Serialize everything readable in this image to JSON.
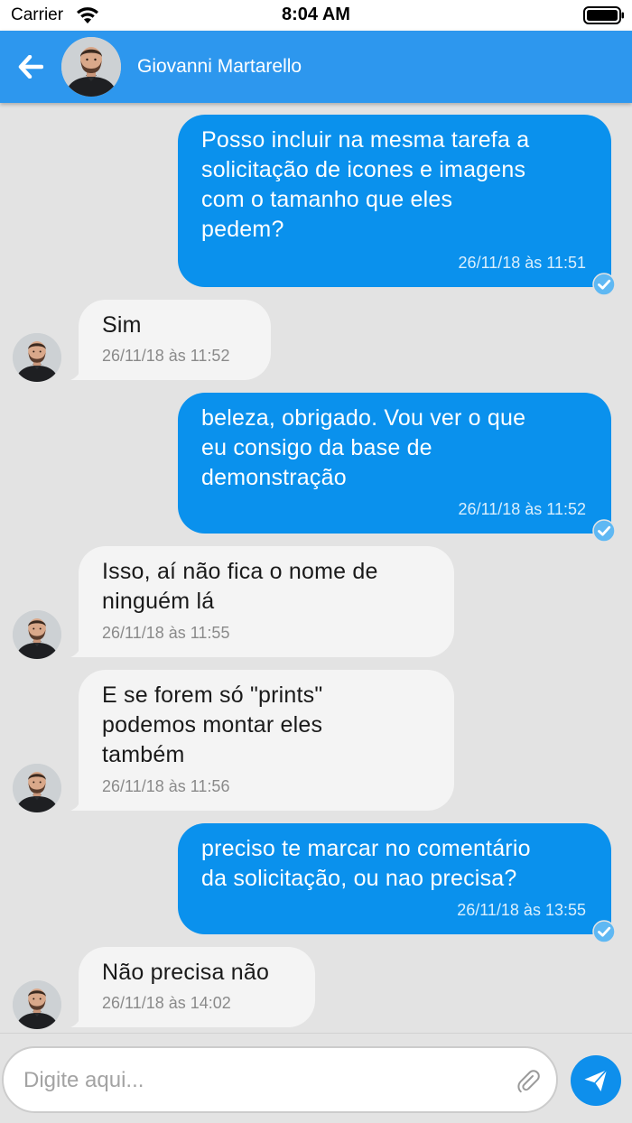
{
  "status_bar": {
    "carrier": "Carrier",
    "time": "8:04 AM",
    "icons": [
      "wifi-icon",
      "battery-icon"
    ]
  },
  "header": {
    "back_icon": "arrow-left-icon",
    "contact_name": "Giovanni Martarello",
    "avatar": "contact-avatar",
    "background_color": "#2d97ee"
  },
  "messages": [
    {
      "direction": "outgoing",
      "text": "Posso incluir na mesma tarefa a\nsolicitação de icones e imagens\ncom o tamanho que eles\npedem?",
      "time": "26/11/18 às 11:51",
      "status_icon": "check-circle-icon"
    },
    {
      "direction": "incoming",
      "text": "Sim",
      "time": "26/11/18 às 11:52"
    },
    {
      "direction": "outgoing",
      "text": "beleza, obrigado. Vou ver o que\neu consigo da base de\ndemonstração",
      "time": "26/11/18 às 11:52",
      "status_icon": "check-circle-icon"
    },
    {
      "direction": "incoming",
      "text": "Isso, aí não fica o nome de\nninguém lá",
      "time": "26/11/18 às 11:55"
    },
    {
      "direction": "incoming",
      "text": "E se forem só \"prints\"\npodemos montar eles\ntambém",
      "time": "26/11/18 às 11:56"
    },
    {
      "direction": "outgoing",
      "text": "preciso te marcar no comentário\nda solicitação, ou nao precisa?",
      "time": "26/11/18 às 13:55",
      "status_icon": "check-circle-icon"
    },
    {
      "direction": "incoming",
      "text": "Não precisa não",
      "time": "26/11/18 às 14:02"
    }
  ],
  "composer": {
    "placeholder": "Digite aqui...",
    "value": "",
    "attach_icon": "paperclip-icon",
    "send_icon": "send-icon"
  },
  "colors": {
    "outgoing_bubble": "#0a91ed",
    "incoming_bubble": "#f4f4f4",
    "chat_background": "#e3e3e3",
    "send_button": "#0e8fec",
    "check_icon": "#5fb8f3"
  }
}
